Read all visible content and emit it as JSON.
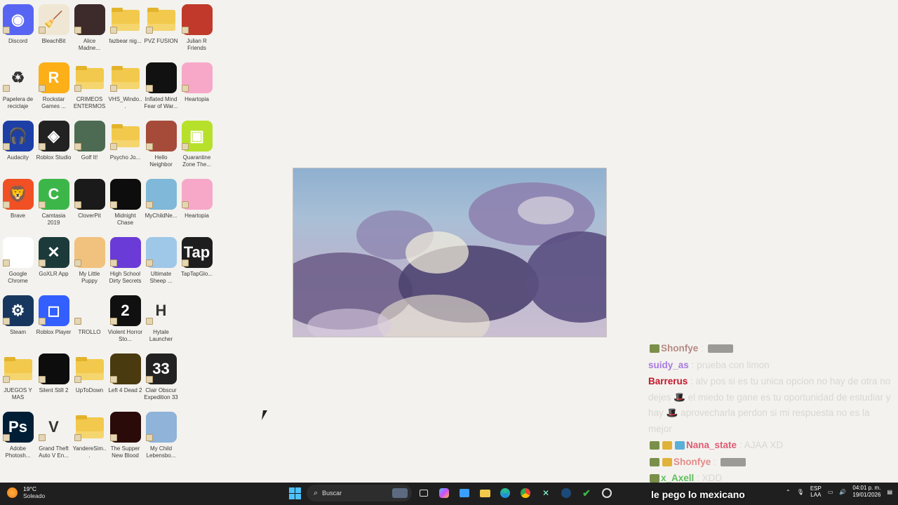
{
  "desktop_icons": [
    {
      "label": "Discord",
      "kind": "app",
      "color": "#5865f2",
      "glyph": "◉",
      "icon": "discord-icon"
    },
    {
      "label": "BleachBit",
      "kind": "app",
      "color": "#efe7d3",
      "glyph": "🧹",
      "icon": "broom-icon"
    },
    {
      "label": "Alice Madne...",
      "kind": "app",
      "color": "#3d2b2b",
      "glyph": "",
      "icon": "alice-icon"
    },
    {
      "label": "fazbear nig...",
      "kind": "folder",
      "icon": "folder-icon"
    },
    {
      "label": "PVZ FUSION",
      "kind": "folder",
      "icon": "folder-icon"
    },
    {
      "label": "Julian R Friends",
      "kind": "app",
      "color": "#c0392b",
      "glyph": "",
      "icon": "julian-icon"
    },
    {
      "label": "Papelera de reciclaje",
      "kind": "app",
      "color": "#f3f2ee",
      "glyph": "♻",
      "icon": "recycle-bin-icon"
    },
    {
      "label": "Rockstar Games ...",
      "kind": "app",
      "color": "#fcaf17",
      "glyph": "R",
      "icon": "rockstar-icon"
    },
    {
      "label": "CRIMEOS ENTERMOS",
      "kind": "folder",
      "icon": "folder-icon"
    },
    {
      "label": "VHS_Windo...",
      "kind": "folder",
      "icon": "folder-icon"
    },
    {
      "label": "Inflated Mind Fear of War...",
      "kind": "app",
      "color": "#111111",
      "glyph": "",
      "icon": "inflated-mind-icon"
    },
    {
      "label": "Heartopia",
      "kind": "app",
      "color": "#f7a8c8",
      "glyph": "",
      "icon": "heartopia-icon"
    },
    {
      "label": "Audacity",
      "kind": "app",
      "color": "#1d3fa6",
      "glyph": "🎧",
      "icon": "audacity-icon"
    },
    {
      "label": "Roblox Studio",
      "kind": "app",
      "color": "#222222",
      "glyph": "◈",
      "icon": "roblox-studio-icon"
    },
    {
      "label": "Golf It!",
      "kind": "app",
      "color": "#4d6b52",
      "glyph": "",
      "icon": "golf-icon"
    },
    {
      "label": "Psycho Jo...",
      "kind": "folder",
      "icon": "folder-icon"
    },
    {
      "label": "Hello Neighbor",
      "kind": "app",
      "color": "#a64b3a",
      "glyph": "",
      "icon": "hello-neighbor-icon"
    },
    {
      "label": "Quarantine Zone The...",
      "kind": "app",
      "color": "#b7e02b",
      "glyph": "▣",
      "icon": "quarantine-icon"
    },
    {
      "label": "Brave",
      "kind": "app",
      "color": "#f05023",
      "glyph": "🦁",
      "icon": "brave-icon"
    },
    {
      "label": "Camtasia 2019",
      "kind": "app",
      "color": "#3db649",
      "glyph": "C",
      "icon": "camtasia-icon"
    },
    {
      "label": "CloverPit",
      "kind": "app",
      "color": "#1a1a1a",
      "glyph": "",
      "icon": "cloverpit-icon"
    },
    {
      "label": "Midnight Chase",
      "kind": "app",
      "color": "#0d0d0d",
      "glyph": "",
      "icon": "midnight-icon"
    },
    {
      "label": "MyChildNe...",
      "kind": "app",
      "color": "#7fb8d8",
      "glyph": "",
      "icon": "mychild-icon"
    },
    {
      "label": "Heartopia",
      "kind": "app",
      "color": "#f7a8c8",
      "glyph": "",
      "icon": "heartopia-icon"
    },
    {
      "label": "Google Chrome",
      "kind": "app",
      "color": "#ffffff",
      "glyph": "",
      "icon": "chrome-icon"
    },
    {
      "label": "GoXLR App",
      "kind": "app",
      "color": "#1c3a3a",
      "glyph": "✕",
      "icon": "goxlr-icon"
    },
    {
      "label": "My Little Puppy",
      "kind": "app",
      "color": "#f1c27d",
      "glyph": "",
      "icon": "puppy-icon"
    },
    {
      "label": "High School Dirty Secrets",
      "kind": "app",
      "color": "#6a3bd6",
      "glyph": "",
      "icon": "highschool-icon"
    },
    {
      "label": "Ultimate Sheep ...",
      "kind": "app",
      "color": "#9fc7e8",
      "glyph": "",
      "icon": "sheep-icon"
    },
    {
      "label": "TapTapGlo...",
      "kind": "app",
      "color": "#1e1e1e",
      "glyph": "Tap",
      "icon": "taptap-icon"
    },
    {
      "label": "Steam",
      "kind": "app",
      "color": "#17375e",
      "glyph": "⚙",
      "icon": "steam-icon"
    },
    {
      "label": "Roblox Player",
      "kind": "app",
      "color": "#335fff",
      "glyph": "◻",
      "icon": "roblox-icon"
    },
    {
      "label": "TROLLO",
      "kind": "app",
      "color": "#f3f2ee",
      "glyph": "",
      "icon": "trollo-icon"
    },
    {
      "label": "Violent Horror Sto...",
      "kind": "app",
      "color": "#101010",
      "glyph": "2",
      "icon": "violent-icon"
    },
    {
      "label": "Hytale Launcher",
      "kind": "app",
      "color": "#f3f2ee",
      "glyph": "H",
      "icon": "hytale-icon"
    },
    {
      "label": "",
      "kind": "blank",
      "icon": "blank"
    },
    {
      "label": "JUEGOS Y MAS",
      "kind": "folder",
      "icon": "folder-icon"
    },
    {
      "label": "Silent Still 2",
      "kind": "app",
      "color": "#0d0d0d",
      "glyph": "",
      "icon": "silent-still-icon"
    },
    {
      "label": "UpToDown",
      "kind": "folder",
      "icon": "folder-icon"
    },
    {
      "label": "Left 4 Dead 2",
      "kind": "app",
      "color": "#4a3a10",
      "glyph": "",
      "icon": "l4d2-icon"
    },
    {
      "label": "Clair Obscur Expedition 33",
      "kind": "app",
      "color": "#222222",
      "glyph": "33",
      "icon": "clair-obscur-icon"
    },
    {
      "label": "",
      "kind": "blank",
      "icon": "blank"
    },
    {
      "label": "Adobe Photosh...",
      "kind": "app",
      "color": "#001e36",
      "glyph": "Ps",
      "icon": "photoshop-icon"
    },
    {
      "label": "Grand Theft Auto V En...",
      "kind": "app",
      "color": "#f3f2ee",
      "glyph": "V",
      "icon": "gta-icon"
    },
    {
      "label": "YandereSim...",
      "kind": "folder",
      "icon": "folder-icon"
    },
    {
      "label": "The Supper New Blood",
      "kind": "app",
      "color": "#2b0a0a",
      "glyph": "",
      "icon": "supper-icon"
    },
    {
      "label": "My Child Lebensbo...",
      "kind": "app",
      "color": "#8fb3d9",
      "glyph": "",
      "icon": "mychild-lebensborn-icon"
    }
  ],
  "chat": [
    {
      "user": "Shonfye",
      "user_color": "#b58a82",
      "text": "",
      "emotes_before": 1,
      "emotes_after_wide": 1
    },
    {
      "user": "suidy_as",
      "user_color": "#a77be0",
      "text": "prueba con limon"
    },
    {
      "user": "Barrerus",
      "user_color": "#c4162a",
      "text": "alv pos si es tu unica opcion no hay de otra no dejes 🎩 el miedo te gane es tu oportunidad de estudiar y hay 🎩 aprovecharla perdon si mi respuesta no es la mejor"
    },
    {
      "user": "Nana_state",
      "user_color": "#e05b73",
      "text": "AJAA XD",
      "emotes_before": 3
    },
    {
      "user": "Shonfye",
      "user_color": "#e58a8a",
      "text": "",
      "emotes_before": 2,
      "emotes_after_wide": 1
    },
    {
      "user": "x_Axell",
      "user_color": "#5fbf5f",
      "text": "XDD",
      "emotes_before": 1
    }
  ],
  "ticker": "le pego lo mexicano",
  "taskbar": {
    "weather_temp": "19°C",
    "weather_desc": "Soleado",
    "search_placeholder": "Buscar",
    "lang_top": "ESP",
    "lang_bottom": "LAA",
    "time": "04:01 p. m.",
    "date": "19/01/2026"
  }
}
